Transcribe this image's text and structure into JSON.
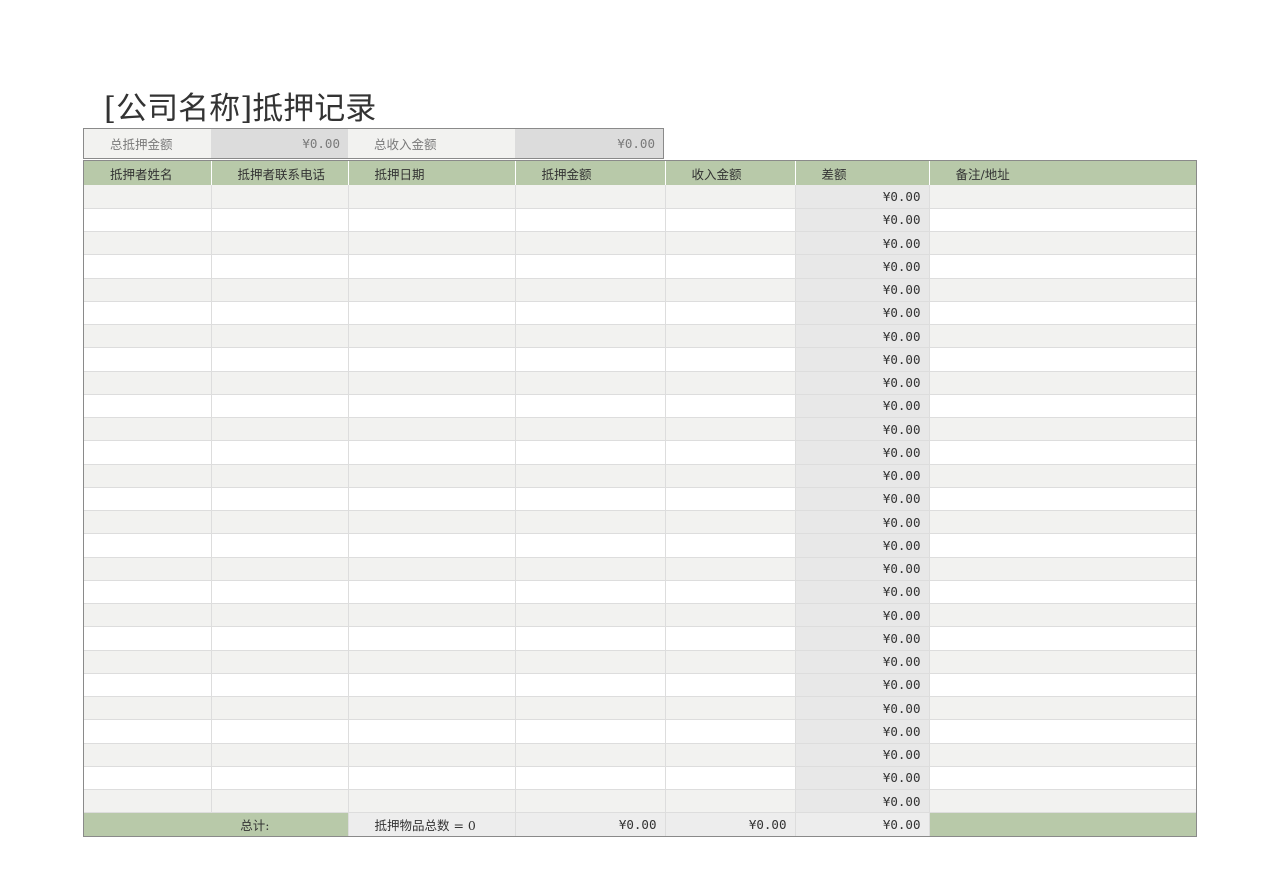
{
  "title": "[公司名称]抵押记录",
  "summary": {
    "total_mortgage_label": "总抵押金额",
    "total_mortgage_value": "¥0.00",
    "total_income_label": "总收入金额",
    "total_income_value": "¥0.00"
  },
  "table": {
    "headers": [
      "抵押者姓名",
      "抵押者联系电话",
      "抵押日期",
      "抵押金额",
      "收入金额",
      "差额",
      "备注/地址"
    ],
    "rows": [
      {
        "name": "",
        "phone": "",
        "date": "",
        "amount": "",
        "income": "",
        "diff": "¥0.00",
        "note": ""
      },
      {
        "name": "",
        "phone": "",
        "date": "",
        "amount": "",
        "income": "",
        "diff": "¥0.00",
        "note": ""
      },
      {
        "name": "",
        "phone": "",
        "date": "",
        "amount": "",
        "income": "",
        "diff": "¥0.00",
        "note": ""
      },
      {
        "name": "",
        "phone": "",
        "date": "",
        "amount": "",
        "income": "",
        "diff": "¥0.00",
        "note": ""
      },
      {
        "name": "",
        "phone": "",
        "date": "",
        "amount": "",
        "income": "",
        "diff": "¥0.00",
        "note": ""
      },
      {
        "name": "",
        "phone": "",
        "date": "",
        "amount": "",
        "income": "",
        "diff": "¥0.00",
        "note": ""
      },
      {
        "name": "",
        "phone": "",
        "date": "",
        "amount": "",
        "income": "",
        "diff": "¥0.00",
        "note": ""
      },
      {
        "name": "",
        "phone": "",
        "date": "",
        "amount": "",
        "income": "",
        "diff": "¥0.00",
        "note": ""
      },
      {
        "name": "",
        "phone": "",
        "date": "",
        "amount": "",
        "income": "",
        "diff": "¥0.00",
        "note": ""
      },
      {
        "name": "",
        "phone": "",
        "date": "",
        "amount": "",
        "income": "",
        "diff": "¥0.00",
        "note": ""
      },
      {
        "name": "",
        "phone": "",
        "date": "",
        "amount": "",
        "income": "",
        "diff": "¥0.00",
        "note": ""
      },
      {
        "name": "",
        "phone": "",
        "date": "",
        "amount": "",
        "income": "",
        "diff": "¥0.00",
        "note": ""
      },
      {
        "name": "",
        "phone": "",
        "date": "",
        "amount": "",
        "income": "",
        "diff": "¥0.00",
        "note": ""
      },
      {
        "name": "",
        "phone": "",
        "date": "",
        "amount": "",
        "income": "",
        "diff": "¥0.00",
        "note": ""
      },
      {
        "name": "",
        "phone": "",
        "date": "",
        "amount": "",
        "income": "",
        "diff": "¥0.00",
        "note": ""
      },
      {
        "name": "",
        "phone": "",
        "date": "",
        "amount": "",
        "income": "",
        "diff": "¥0.00",
        "note": ""
      },
      {
        "name": "",
        "phone": "",
        "date": "",
        "amount": "",
        "income": "",
        "diff": "¥0.00",
        "note": ""
      },
      {
        "name": "",
        "phone": "",
        "date": "",
        "amount": "",
        "income": "",
        "diff": "¥0.00",
        "note": ""
      },
      {
        "name": "",
        "phone": "",
        "date": "",
        "amount": "",
        "income": "",
        "diff": "¥0.00",
        "note": ""
      },
      {
        "name": "",
        "phone": "",
        "date": "",
        "amount": "",
        "income": "",
        "diff": "¥0.00",
        "note": ""
      },
      {
        "name": "",
        "phone": "",
        "date": "",
        "amount": "",
        "income": "",
        "diff": "¥0.00",
        "note": ""
      },
      {
        "name": "",
        "phone": "",
        "date": "",
        "amount": "",
        "income": "",
        "diff": "¥0.00",
        "note": ""
      },
      {
        "name": "",
        "phone": "",
        "date": "",
        "amount": "",
        "income": "",
        "diff": "¥0.00",
        "note": ""
      },
      {
        "name": "",
        "phone": "",
        "date": "",
        "amount": "",
        "income": "",
        "diff": "¥0.00",
        "note": ""
      },
      {
        "name": "",
        "phone": "",
        "date": "",
        "amount": "",
        "income": "",
        "diff": "¥0.00",
        "note": ""
      },
      {
        "name": "",
        "phone": "",
        "date": "",
        "amount": "",
        "income": "",
        "diff": "¥0.00",
        "note": ""
      },
      {
        "name": "",
        "phone": "",
        "date": "",
        "amount": "",
        "income": "",
        "diff": "¥0.00",
        "note": ""
      }
    ],
    "footer": {
      "total_label": "总计:",
      "count_label": "抵押物品总数 = 0",
      "amount_total": "¥0.00",
      "income_total": "¥0.00",
      "diff_total": "¥0.00"
    }
  },
  "colors": {
    "header_green": "#b8c9a9",
    "stripe": "#f2f2f0",
    "diff_column": "#e8e8e8"
  }
}
